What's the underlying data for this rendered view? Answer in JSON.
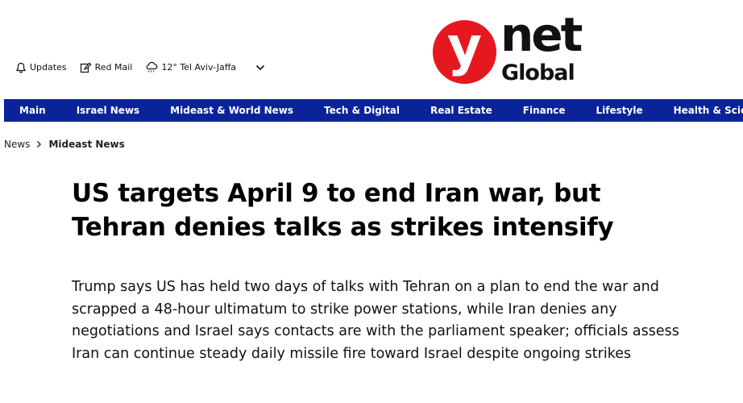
{
  "utility": {
    "updates": "Updates",
    "red_mail": "Red Mail",
    "weather": "12° Tel Aviv-Jaffa"
  },
  "logo": {
    "y": "y",
    "net": "net",
    "global": "Global"
  },
  "nav": {
    "items": [
      {
        "label": "Main"
      },
      {
        "label": "Israel News"
      },
      {
        "label": "Mideast & World News"
      },
      {
        "label": "Tech & Digital"
      },
      {
        "label": "Real Estate"
      },
      {
        "label": "Finance"
      },
      {
        "label": "Lifestyle"
      },
      {
        "label": "Health & Science"
      }
    ]
  },
  "breadcrumb": {
    "root": "News",
    "current": "Mideast News"
  },
  "article": {
    "title": "US targets April 9 to end Iran war, but Tehran denies talks as strikes intensify",
    "subtitle": "Trump says US has held two days of talks with Tehran on a plan to end the war and scrapped a 48-hour ultimatum to strike power stations, while Iran denies any negotiations and Israel says contacts are with the parliament speaker; officials assess Iran can continue steady daily missile fire toward Israel despite ongoing strikes"
  },
  "colors": {
    "nav_bg": "#0b2399",
    "logo_red": "#e5171f"
  }
}
